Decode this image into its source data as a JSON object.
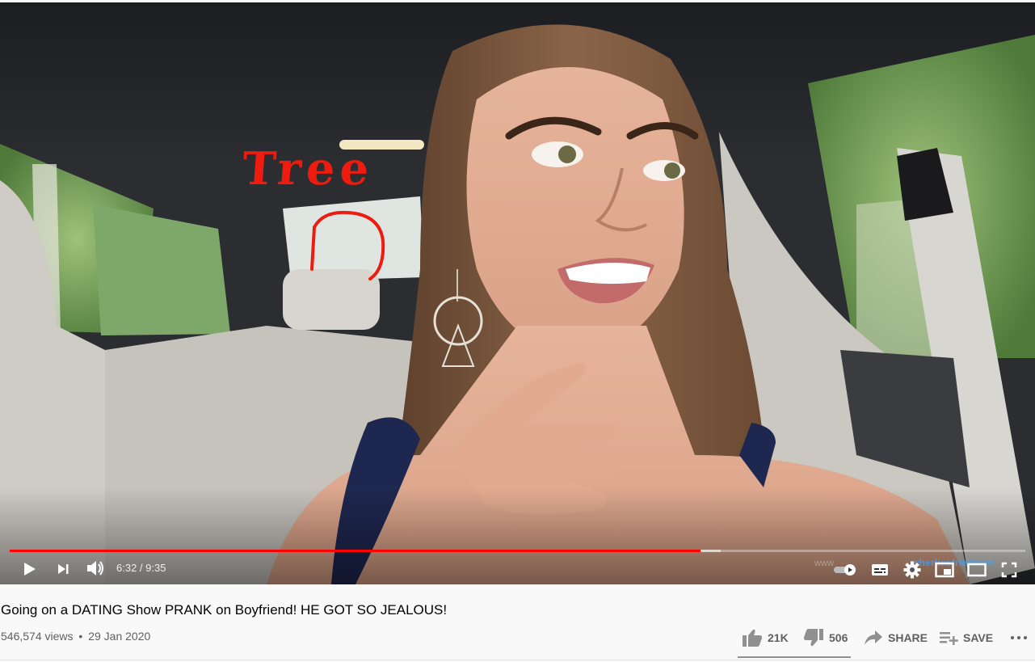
{
  "player": {
    "overlay_text": "Tree",
    "time_current": "6:32",
    "time_separator": " / ",
    "time_total": "9:35",
    "progress_played": 0.68,
    "progress_buffered": 0.7,
    "progress_color": "#ff0000",
    "watermark": "wherliesfriedman",
    "watermark_left": "www"
  },
  "video": {
    "title": "Going on a DATING Show PRANK on Boyfriend! HE GOT SO JEALOUS!",
    "views": "546,574 views",
    "separator": "•",
    "date": "29 Jan 2020"
  },
  "actions": {
    "likes": "21K",
    "dislikes": "506",
    "share": "SHARE",
    "save": "SAVE",
    "like_ratio": 0.98
  },
  "icons": {
    "play": "play-icon",
    "next": "next-icon",
    "volume": "volume-icon",
    "autoplay": "autoplay-toggle-icon",
    "subtitles": "subtitles-icon",
    "settings": "gear-icon",
    "miniplayer": "miniplayer-icon",
    "theater": "theater-mode-icon",
    "fullscreen": "fullscreen-icon",
    "like": "thumbs-up-icon",
    "dislike": "thumbs-down-icon",
    "share": "share-arrow-icon",
    "save": "playlist-add-icon",
    "more": "more-horizontal-icon"
  }
}
